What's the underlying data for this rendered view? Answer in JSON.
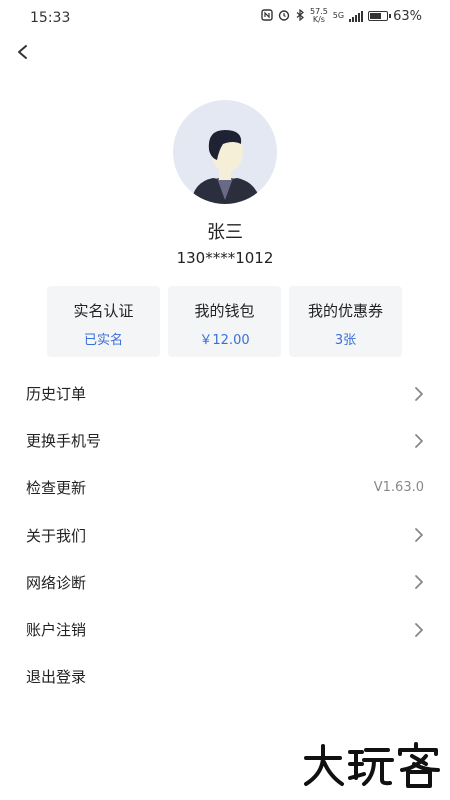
{
  "status_bar": {
    "time": "15:33",
    "network_speed_top": "57.5",
    "network_speed_bottom": "K/s",
    "network_type": "5G",
    "battery": "63%",
    "battery_level": 0.63,
    "icons": [
      "nfc-icon",
      "alarm-icon",
      "bluetooth-icon",
      "signal-icon",
      "battery-icon"
    ]
  },
  "nav": {
    "back_icon": "chevron-left-icon"
  },
  "profile": {
    "name": "张三",
    "phone": "130****1012"
  },
  "cards": [
    {
      "title": "实名认证",
      "value": "已实名"
    },
    {
      "title": "我的钱包",
      "value": "￥12.00"
    },
    {
      "title": "我的优惠券",
      "value": "3张"
    }
  ],
  "menu": [
    {
      "label": "历史订单",
      "value": "",
      "chevron": true
    },
    {
      "label": "更换手机号",
      "value": "",
      "chevron": true
    },
    {
      "label": "检查更新",
      "value": "V1.63.0",
      "chevron": false
    },
    {
      "label": "关于我们",
      "value": "",
      "chevron": true
    },
    {
      "label": "网络诊断",
      "value": "",
      "chevron": true
    },
    {
      "label": "账户注销",
      "value": "",
      "chevron": true
    },
    {
      "label": "退出登录",
      "value": "",
      "chevron": false
    }
  ],
  "watermark": {
    "text": "大玩客"
  },
  "colors": {
    "accent": "#3a6fd8",
    "card_bg": "#f4f5f7",
    "avatar_bg": "#e4e8f2"
  }
}
